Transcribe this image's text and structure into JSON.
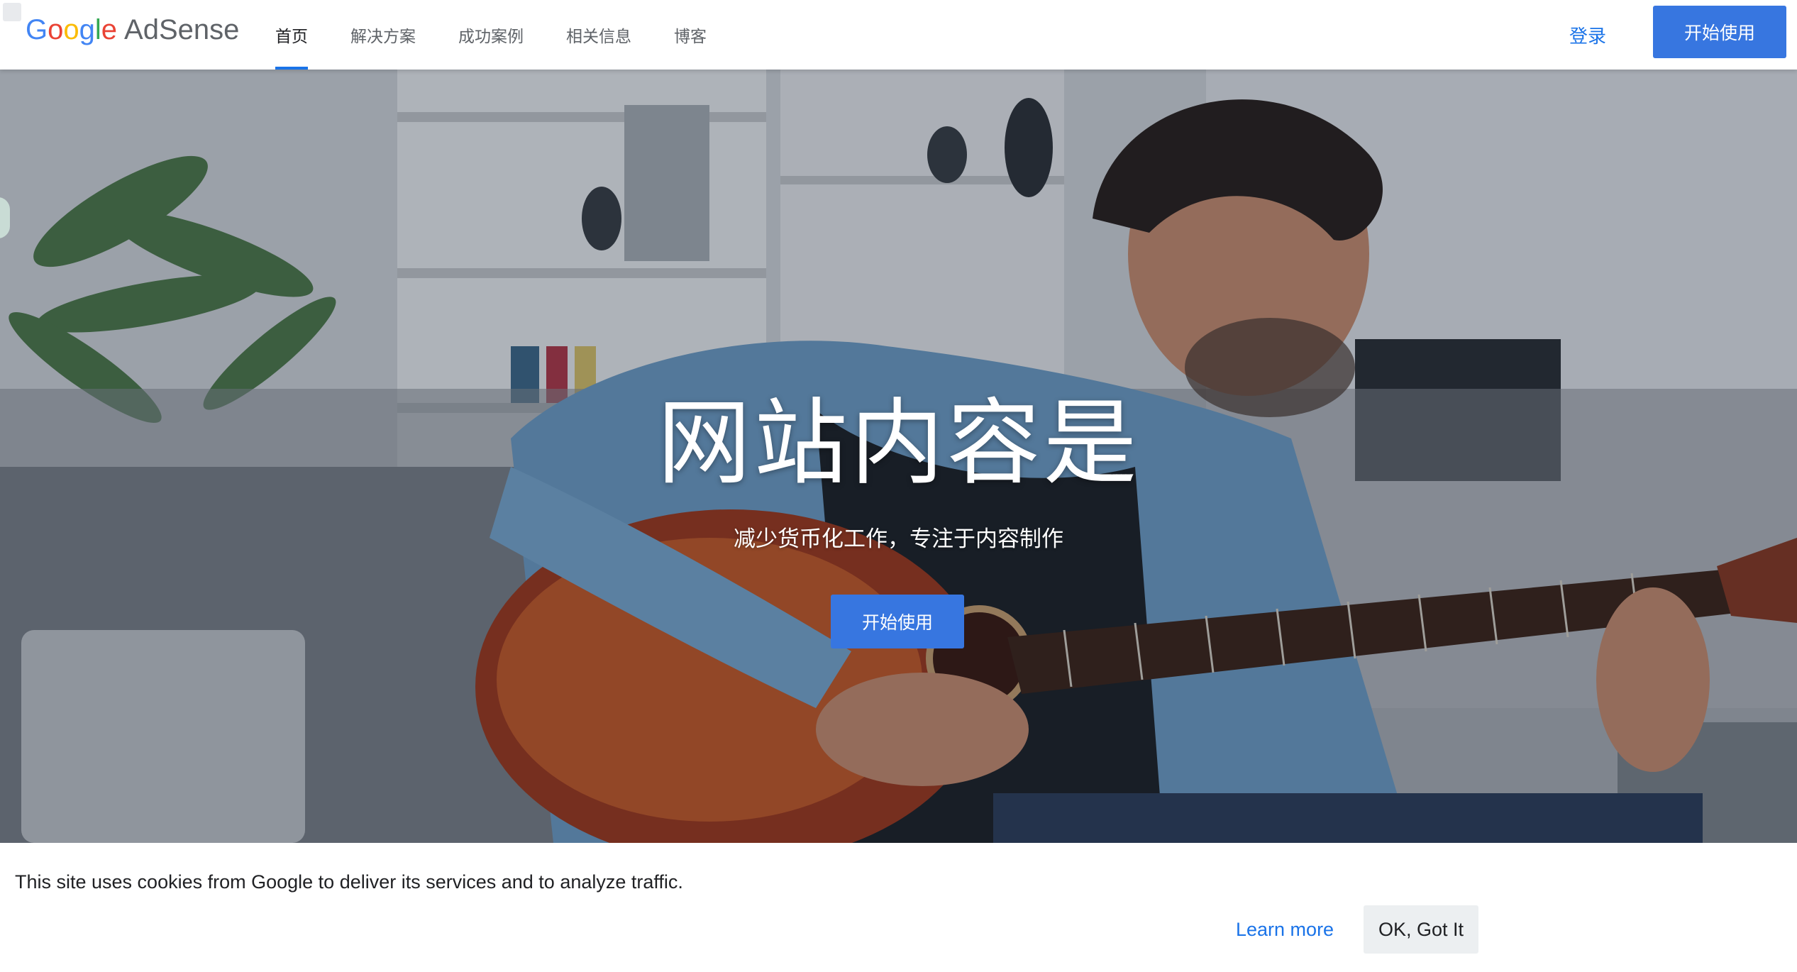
{
  "brand": {
    "google_letters": [
      "G",
      "o",
      "o",
      "g",
      "l",
      "e"
    ],
    "google_colors": [
      "#4285F4",
      "#EA4335",
      "#FBBC05",
      "#4285F4",
      "#34A853",
      "#EA4335"
    ],
    "product": "AdSense"
  },
  "nav": {
    "items": [
      {
        "label": "首页",
        "active": true
      },
      {
        "label": "解决方案",
        "active": false
      },
      {
        "label": "成功案例",
        "active": false
      },
      {
        "label": "相关信息",
        "active": false
      },
      {
        "label": "博客",
        "active": false
      }
    ],
    "signin_label": "登录",
    "cta_label": "开始使用"
  },
  "hero": {
    "title": "网站内容是",
    "subtitle": "减少货币化工作，专注于内容制作",
    "cta_label": "开始使用",
    "image": "man-playing-acoustic-guitar-on-sofa"
  },
  "cookie": {
    "message": "This site uses cookies from Google to deliver its services and to analyze traffic.",
    "learn_more_label": "Learn more",
    "ok_label": "OK, Got It"
  },
  "colors": {
    "accent": "#1a73e8",
    "button_blue": "#3776e0"
  }
}
